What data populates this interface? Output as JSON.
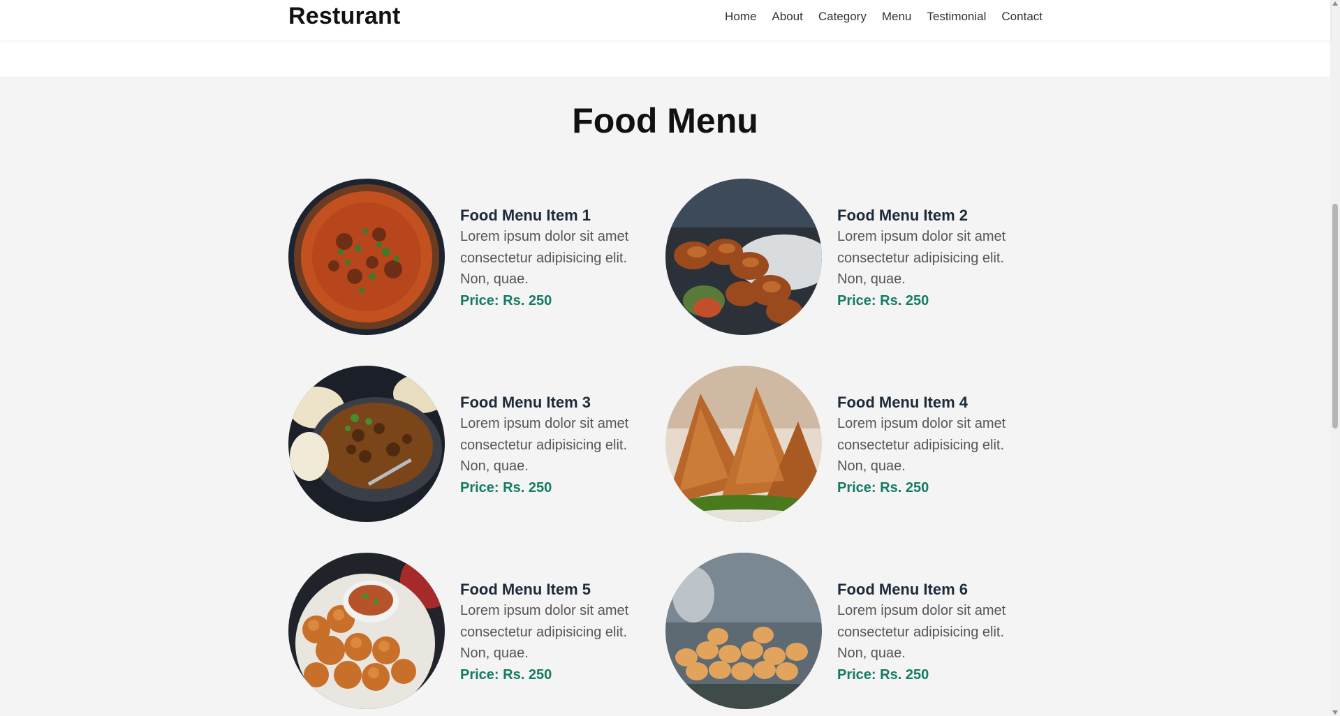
{
  "navbar": {
    "brand": "Resturant",
    "links": [
      "Home",
      "About",
      "Category",
      "Menu",
      "Testimonial",
      "Contact"
    ]
  },
  "menu": {
    "title": "Food Menu",
    "items": [
      {
        "name": "Food Menu Item 1",
        "desc": "Lorem ipsum dolor sit amet consectetur adipisicing elit. Non, quae.",
        "price": "Price: Rs. 250",
        "image": "curry-bowl-image"
      },
      {
        "name": "Food Menu Item 2",
        "desc": "Lorem ipsum dolor sit amet consectetur adipisicing elit. Non, quae.",
        "price": "Price: Rs. 250",
        "image": "fried-patties-image"
      },
      {
        "name": "Food Menu Item 3",
        "desc": "Lorem ipsum dolor sit amet consectetur adipisicing elit. Non, quae.",
        "price": "Price: Rs. 250",
        "image": "curry-pan-image"
      },
      {
        "name": "Food Menu Item 4",
        "desc": "Lorem ipsum dolor sit amet consectetur adipisicing elit. Non, quae.",
        "price": "Price: Rs. 250",
        "image": "samosa-image"
      },
      {
        "name": "Food Menu Item 5",
        "desc": "Lorem ipsum dolor sit amet consectetur adipisicing elit. Non, quae.",
        "price": "Price: Rs. 250",
        "image": "pav-bhaji-image"
      },
      {
        "name": "Food Menu Item 6",
        "desc": "Lorem ipsum dolor sit amet consectetur adipisicing elit. Non, quae.",
        "price": "Price: Rs. 250",
        "image": "pani-puri-image"
      }
    ]
  },
  "colors": {
    "section_bg": "#f4f4f4",
    "item_title": "#1c2a3a",
    "price": "#147a64",
    "nav_text": "#333333"
  }
}
